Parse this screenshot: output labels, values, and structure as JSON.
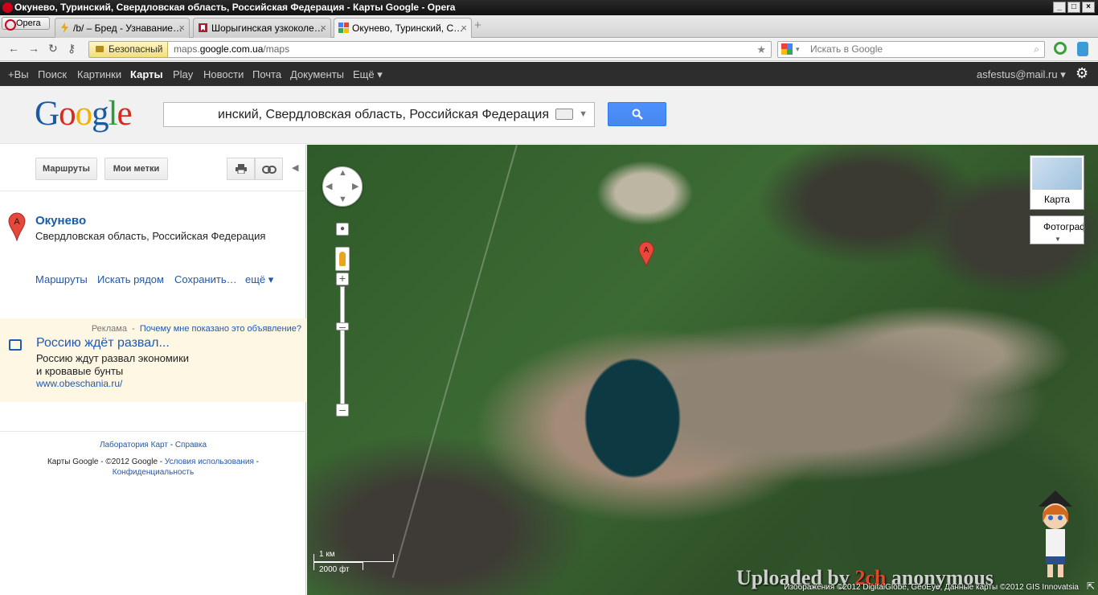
{
  "window": {
    "title": "Окунево, Туринский, Свердловская область, Российская Федерация - Карты Google - Opera"
  },
  "browser": {
    "menu_label": "Opera",
    "tabs": [
      {
        "label": "/b/ – Бред - Узнавание…",
        "icon": "lightning-icon"
      },
      {
        "label": "Шорыгинская узкоколе…",
        "icon": "bookmark-icon"
      },
      {
        "label": "Окунево, Туринский, С…",
        "icon": "google-maps-icon"
      }
    ],
    "security_label": "Безопасный",
    "url_prefix": "maps.",
    "url_host": "google.com.ua",
    "url_path": "/maps",
    "search_placeholder": "Искать в Google"
  },
  "google_bar": {
    "items": [
      "+Вы",
      "Поиск",
      "Картинки",
      "Карты",
      "Play",
      "Новости",
      "Почта",
      "Документы",
      "Ещё ▾"
    ],
    "active": "Карты",
    "account": "asfestus@mail.ru ▾"
  },
  "search": {
    "query": "инский, Свердловская область, Российская Федерация"
  },
  "logo": {
    "letters": [
      "G",
      "o",
      "o",
      "g",
      "l",
      "e"
    ],
    "colors": [
      "#1a5ba6",
      "#d52b1e",
      "#f2b100",
      "#1a5ba6",
      "#2a9c3a",
      "#d52b1e"
    ]
  },
  "panel": {
    "routes_button": "Маршруты",
    "my_places_button": "Мои метки",
    "place": {
      "marker": "A",
      "name": "Окунево",
      "address": "Свердловская область, Российская Федерация"
    },
    "actions": [
      "Маршруты",
      "Искать рядом",
      "Сохранить…",
      "ещё ▾"
    ],
    "ad": {
      "label": "Реклама",
      "why_link": "Почему мне показано это объявление?",
      "title": "Россию ждёт развал...",
      "line1": "Россию ждут развал экономики",
      "line2": "и кровавые бунты",
      "url": "www.obeschania.ru/"
    },
    "footer": {
      "labs": "Лаборатория Карт",
      "sep": " - ",
      "help": "Справка",
      "copyright": "Карты Google - ©2012 Google - ",
      "terms": "Условия использования",
      "dash": " -",
      "privacy": "Конфиденциальность"
    }
  },
  "map": {
    "marker": "A",
    "layer_map_label": "Карта",
    "layer_satellite_label": "Фотограф",
    "scale_km": "1 км",
    "scale_ft": "2000 фт",
    "watermark_pre": "Uploaded by ",
    "watermark_red": "2ch",
    "watermark_post": " anonymous",
    "copyright": "Изображения ©2012 DigitalGlobe, GeoEye, Данные карты ©2012 GIS Innovatsia"
  }
}
